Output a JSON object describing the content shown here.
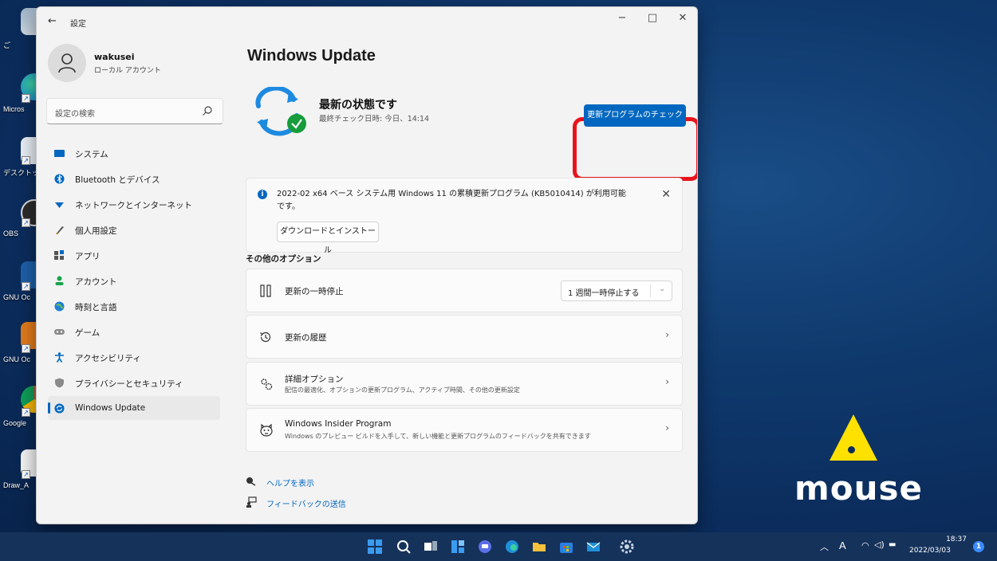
{
  "window": {
    "title": "設定",
    "back_glyph": "←",
    "minimize_glyph": "−",
    "maximize_glyph": "□",
    "close_glyph": "✕"
  },
  "profile": {
    "name": "wakusei",
    "account_type": "ローカル アカウント"
  },
  "search": {
    "placeholder": "設定の検索"
  },
  "sidebar": {
    "items": [
      {
        "label": "システム",
        "icon": "system-icon"
      },
      {
        "label": "Bluetooth とデバイス",
        "icon": "bluetooth-icon"
      },
      {
        "label": "ネットワークとインターネット",
        "icon": "network-icon"
      },
      {
        "label": "個人用設定",
        "icon": "personalization-icon"
      },
      {
        "label": "アプリ",
        "icon": "apps-icon"
      },
      {
        "label": "アカウント",
        "icon": "accounts-icon"
      },
      {
        "label": "時刻と言語",
        "icon": "time-language-icon"
      },
      {
        "label": "ゲーム",
        "icon": "gaming-icon"
      },
      {
        "label": "アクセシビリティ",
        "icon": "accessibility-icon"
      },
      {
        "label": "プライバシーとセキュリティ",
        "icon": "privacy-icon"
      },
      {
        "label": "Windows Update",
        "icon": "windows-update-icon",
        "active": true
      }
    ]
  },
  "main": {
    "title": "Windows Update",
    "status_title": "最新の状態です",
    "status_sub": "最終チェック日時: 今日、14:14",
    "check_button": "更新プログラムのチェック",
    "update_card": {
      "text": "2022-02 x64 ベース システム用 Windows 11 の累積更新プログラム (KB5010414) が利用可能です。",
      "download_button": "ダウンロードとインストール",
      "close_glyph": "✕"
    },
    "other_options_heading": "その他のオプション",
    "options": {
      "pause": {
        "label": "更新の一時停止",
        "select_value": "1 週間一時停止する"
      },
      "history": {
        "label": "更新の履歴"
      },
      "advanced": {
        "label": "詳細オプション",
        "sub": "配信の最適化、オプションの更新プログラム、アクティブ時間、その他の更新設定"
      },
      "insider": {
        "label": "Windows Insider Program",
        "sub": "Windows のプレビュー ビルドを入手して、新しい機能と更新プログラムのフィードバックを共有できます"
      }
    },
    "chevron_glyph": "›",
    "help_link": "ヘルプを表示",
    "feedback_link": "フィードバックの送信"
  },
  "desktop": {
    "icons": [
      "ご",
      "Micros",
      "デスクトッ",
      "OBS",
      "GNU Oc",
      "GNU Oc",
      "Google",
      "Draw_A"
    ],
    "logo_text": "mouse"
  },
  "taskbar": {
    "ime": "A",
    "time": "18:37",
    "date": "2022/03/03",
    "notifications": "1"
  },
  "colors": {
    "accent": "#0067c0",
    "highlight": "#e8141c",
    "logo_yellow": "#ffe100"
  }
}
